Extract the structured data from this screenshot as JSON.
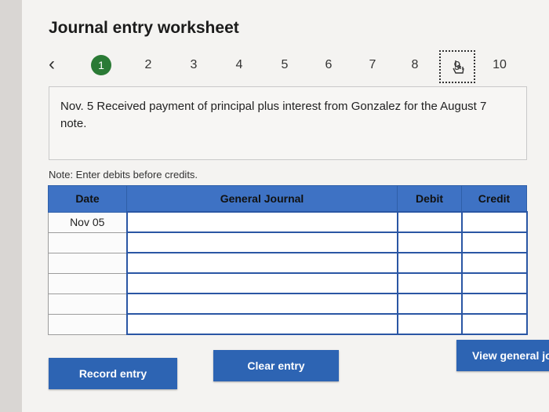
{
  "worksheet": {
    "title": "Journal entry worksheet",
    "prev_icon": "chevron-left-icon",
    "pages": [
      "1",
      "2",
      "3",
      "4",
      "5",
      "6",
      "7",
      "8",
      "9",
      "10"
    ],
    "active_page": "1"
  },
  "prompt": {
    "text": "Nov. 5 Received payment of principal plus interest from Gonzalez for the August 7 note."
  },
  "note": "Note: Enter debits before credits.",
  "journal": {
    "headers": {
      "date": "Date",
      "account": "General Journal",
      "debit": "Debit",
      "credit": "Credit"
    },
    "rows": [
      {
        "date": "Nov 05",
        "account": "",
        "debit": "",
        "credit": ""
      },
      {
        "date": "",
        "account": "",
        "debit": "",
        "credit": ""
      },
      {
        "date": "",
        "account": "",
        "debit": "",
        "credit": ""
      },
      {
        "date": "",
        "account": "",
        "debit": "",
        "credit": ""
      },
      {
        "date": "",
        "account": "",
        "debit": "",
        "credit": ""
      },
      {
        "date": "",
        "account": "",
        "debit": "",
        "credit": ""
      }
    ]
  },
  "buttons": {
    "record": "Record entry",
    "clear": "Clear entry",
    "view": "View general jo"
  },
  "colors": {
    "header_blue": "#3e72c4",
    "button_blue": "#2d64b3",
    "active_page_green": "#2a7a35"
  }
}
